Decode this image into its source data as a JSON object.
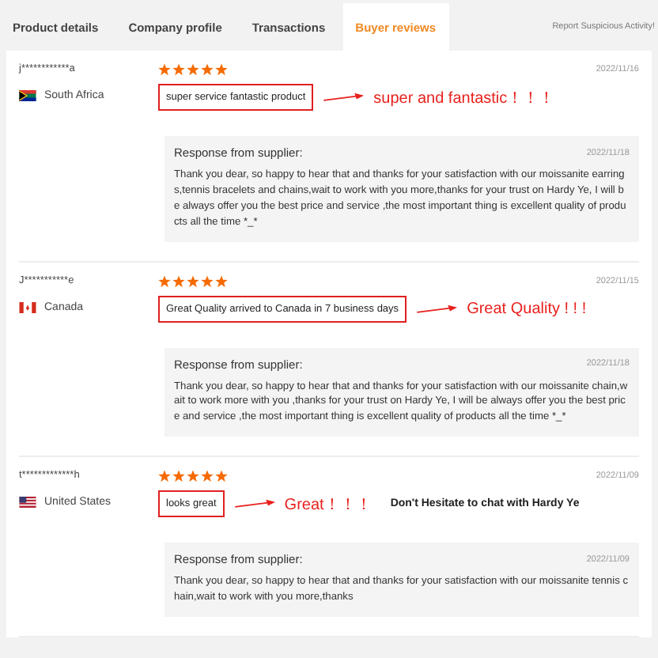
{
  "tabs": [
    {
      "label": "Product details",
      "selected": false
    },
    {
      "label": "Company profile",
      "selected": false
    },
    {
      "label": "Transactions",
      "selected": false
    },
    {
      "label": "Buyer reviews",
      "selected": true
    }
  ],
  "report_link": "Report Suspicious Activity!",
  "reviews": [
    {
      "buyer": "j************a",
      "country": "South Africa",
      "kind": "za",
      "stars": 5,
      "date": "2022/11/16",
      "comment": "super service fantastic product",
      "annotation": "super and fantastic！！！",
      "response": {
        "title": "Response from supplier:",
        "date": "2022/11/18",
        "text": "Thank you dear, so happy to hear that and thanks for your satisfaction with our moissanite earrings,tennis bracelets and chains,wait to work with you more,thanks for your trust on Hardy Ye, I will be always offer you the best price and service ,the most important thing is excellent quality of products all the time *_*"
      }
    },
    {
      "buyer": "J***********e",
      "country": "Canada",
      "kind": "ca",
      "stars": 5,
      "date": "2022/11/15",
      "comment": "Great Quality arrived to Canada in 7 business days",
      "annotation": "Great Quality ! ! !",
      "response": {
        "title": "Response from supplier:",
        "date": "2022/11/18",
        "text": "Thank you dear, so happy to hear that and thanks for your satisfaction with our moissanite chain,wait to work more with you ,thanks for your trust on Hardy Ye, I will be always offer you the best price and service ,the most important thing is excellent quality of products all the time *_*"
      }
    },
    {
      "buyer": "t*************h",
      "country": "United States",
      "kind": "us",
      "stars": 5,
      "date": "2022/11/09",
      "comment": "looks great",
      "annotation": "Great！！！",
      "extra_note": "Don't Hesitate to chat with Hardy Ye",
      "response": {
        "title": "Response from supplier:",
        "date": "2022/11/09",
        "text": "Thank you dear, so happy to hear that and thanks for your satisfaction with our moissanite tennis chain,wait to work with you more,thanks"
      }
    }
  ]
}
